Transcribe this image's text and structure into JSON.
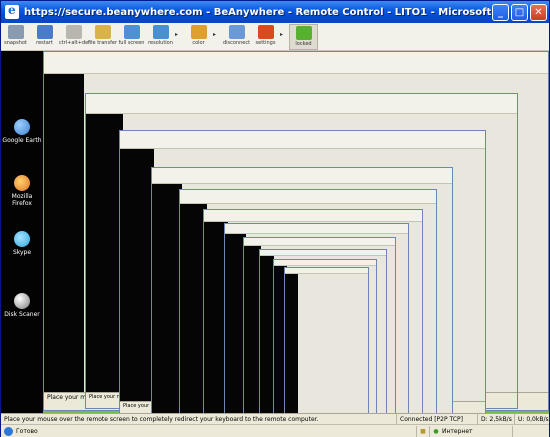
{
  "window": {
    "title": "https://secure.beanywhere.com - BeAnywhere - Remote Control - LITO1 - Microsoft Internet Explorer",
    "buttons": {
      "minimize": "_",
      "maximize": "□",
      "close": "✕"
    }
  },
  "toolbar": {
    "items": [
      {
        "label": "snapshot",
        "icon": "camera-icon",
        "color": "#8a9bb0"
      },
      {
        "label": "restart",
        "icon": "restart-icon",
        "color": "#4a7bc8"
      },
      {
        "label": "ctrl+alt+del",
        "icon": "keyboard-icon",
        "color": "#b9b7ad"
      },
      {
        "label": "file transfer",
        "icon": "folder-transfer-icon",
        "color": "#d9b34a"
      },
      {
        "label": "full screen",
        "icon": "monitor-icon",
        "color": "#4f8fd6"
      },
      {
        "label": "resolution",
        "icon": "resolution-icon",
        "color": "#4a8fd0"
      },
      {
        "label": "color",
        "icon": "palette-icon",
        "color": "#e0a030"
      },
      {
        "label": "disconnect",
        "icon": "disconnect-icon",
        "color": "#6a9ad6"
      },
      {
        "label": "settings",
        "icon": "gear-icon",
        "color": "#d94a1f"
      },
      {
        "label": "locked",
        "icon": "lock-icon",
        "color": "#58b02f"
      }
    ]
  },
  "desktop": {
    "icons": [
      {
        "label": "Google Earth",
        "icon": "google-earth-icon",
        "color": "#3b7fd1"
      },
      {
        "label": "Mozilla Firefox",
        "icon": "firefox-icon",
        "color": "#e0702a"
      },
      {
        "label": "Skype",
        "icon": "skype-icon",
        "color": "#2aa7e0"
      },
      {
        "label": "Disk Scaner",
        "icon": "disk-scanner-icon",
        "color": "#b8b8b8"
      }
    ]
  },
  "nested": {
    "status_message": "Place your mouse over the remote screen to completely redirect your keyboard to the remote computer.",
    "connection": "Connected [P2P TCP]",
    "download": "D: 2,9kB/s",
    "upload": "U: 0,0kB/s",
    "ie_done": "Готово",
    "ie_zone": "Интернет"
  },
  "statusbar": {
    "message": "Place your mouse over the remote screen to completely redirect your keyboard to the remote computer.",
    "connection": "Connected [P2P TCP]",
    "download": "D: 2,5kB/s",
    "upload": "U: 0,0kB/s"
  },
  "ie_statusbar": {
    "done": "Готово",
    "zone": "Интернет"
  },
  "colors": {
    "accent": "#0a5ae0",
    "remote_bg": "#7fb94a",
    "desktop_bg": "#030303"
  }
}
